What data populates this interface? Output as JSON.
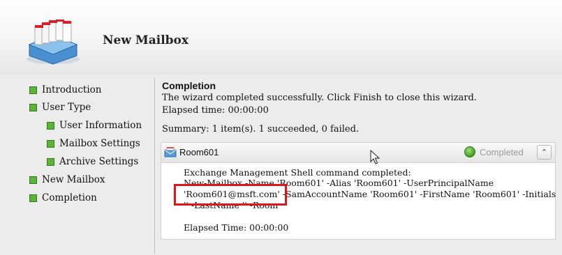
{
  "header": {
    "title": "New Mailbox",
    "icon": "mailbox-wizard-icon"
  },
  "sidebar": {
    "items": [
      {
        "label": "Introduction",
        "indent": 0
      },
      {
        "label": "User Type",
        "indent": 0
      },
      {
        "label": "User Information",
        "indent": 1
      },
      {
        "label": "Mailbox Settings",
        "indent": 1
      },
      {
        "label": "Archive Settings",
        "indent": 1
      },
      {
        "label": "New Mailbox",
        "indent": 0
      },
      {
        "label": "Completion",
        "indent": 0
      }
    ],
    "bullet_color": "#5cb23a"
  },
  "main": {
    "title": "Completion",
    "message": "The wizard completed successfully. Click Finish to close this wizard.",
    "elapsed": "Elapsed time: 00:00:00",
    "summary": "Summary: 1 item(s). 1 succeeded, 0 failed."
  },
  "result": {
    "name": "Room601",
    "status": "Completed",
    "lines": [
      "Exchange Management Shell command completed:",
      "New-Mailbox -Name 'Room601' -Alias 'Room601' -UserPrincipalName",
      "'Room601@msft.com' -SamAccountName 'Room601' -FirstName 'Room601' -Initials",
      "'' -LastName '' -Room"
    ],
    "elapsed": "Elapsed Time: 00:00:00",
    "highlight_color": "#e0161b"
  }
}
